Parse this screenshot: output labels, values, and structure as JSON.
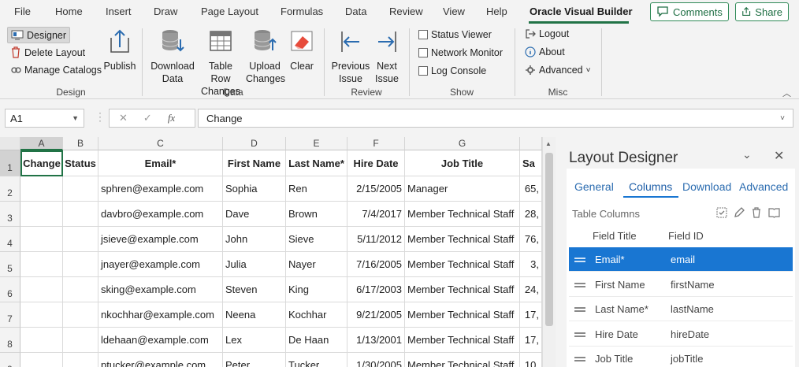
{
  "tabs": [
    "File",
    "Home",
    "Insert",
    "Draw",
    "Page Layout",
    "Formulas",
    "Data",
    "Review",
    "View",
    "Help",
    "Oracle Visual Builder"
  ],
  "comments_label": "Comments",
  "share_label": "Share",
  "ribbon": {
    "design": {
      "designer": "Designer",
      "delete_layout": "Delete Layout",
      "manage_catalogs": "Manage Catalogs",
      "publish": "Publish",
      "label": "Design"
    },
    "data": {
      "download1": "Download",
      "download2": "Data",
      "trc1": "Table Row",
      "trc2": "Changes",
      "upload1": "Upload",
      "upload2": "Changes",
      "clear": "Clear",
      "label": "Data"
    },
    "review": {
      "prev1": "Previous",
      "prev2": "Issue",
      "next1": "Next",
      "next2": "Issue",
      "label": "Review"
    },
    "show": {
      "status_viewer": "Status Viewer",
      "network_monitor": "Network Monitor",
      "log_console": "Log Console",
      "label": "Show"
    },
    "misc": {
      "logout": "Logout",
      "about": "About",
      "advanced": "Advanced",
      "label": "Misc"
    }
  },
  "formula": {
    "name_box": "A1",
    "fx": "fx",
    "value": "Change"
  },
  "grid": {
    "col_letters": [
      "A",
      "B",
      "C",
      "D",
      "E",
      "F",
      "G",
      ""
    ],
    "headers": [
      "Change",
      "Status",
      "Email*",
      "First Name",
      "Last Name*",
      "Hire Date",
      "Job Title",
      "Sa"
    ],
    "rows": [
      {
        "n": "2",
        "email": "sphren@example.com",
        "first": "Sophia",
        "last": "Ren",
        "hire": "2/15/2005",
        "job": "Manager",
        "sal": "65,"
      },
      {
        "n": "3",
        "email": "davbro@example.com",
        "first": "Dave",
        "last": "Brown",
        "hire": "7/4/2017",
        "job": "Member Technical Staff",
        "sal": "28,"
      },
      {
        "n": "4",
        "email": "jsieve@example.com",
        "first": "John",
        "last": "Sieve",
        "hire": "5/11/2012",
        "job": "Member Technical Staff",
        "sal": "76,"
      },
      {
        "n": "5",
        "email": "jnayer@example.com",
        "first": "Julia",
        "last": "Nayer",
        "hire": "7/16/2005",
        "job": "Member Technical Staff",
        "sal": "3,"
      },
      {
        "n": "6",
        "email": "sking@example.com",
        "first": "Steven",
        "last": "King",
        "hire": "6/17/2003",
        "job": "Member Technical Staff",
        "sal": "24,"
      },
      {
        "n": "7",
        "email": "nkochhar@example.com",
        "first": "Neena",
        "last": "Kochhar",
        "hire": "9/21/2005",
        "job": "Member Technical Staff",
        "sal": "17,"
      },
      {
        "n": "8",
        "email": "ldehaan@example.com",
        "first": "Lex",
        "last": "De Haan",
        "hire": "1/13/2001",
        "job": "Member Technical Staff",
        "sal": "17,"
      },
      {
        "n": "9",
        "email": "ptucker@example.com",
        "first": "Peter",
        "last": "Tucker",
        "hire": "1/30/2005",
        "job": "Member Technical Staff",
        "sal": "10,"
      }
    ]
  },
  "pane": {
    "title": "Layout Designer",
    "tabs": [
      "General",
      "Columns",
      "Download",
      "Advanced"
    ],
    "section": "Table Columns",
    "col_field_title": "Field Title",
    "col_field_id": "Field ID",
    "fields": [
      {
        "title": "Email*",
        "id": "email"
      },
      {
        "title": "First Name",
        "id": "firstName"
      },
      {
        "title": "Last Name*",
        "id": "lastName"
      },
      {
        "title": "Hire Date",
        "id": "hireDate"
      },
      {
        "title": "Job Title",
        "id": "jobTitle"
      }
    ]
  },
  "colors": {
    "accent_green": "#217346",
    "accent_blue": "#1976d2",
    "link_blue": "#2b6cb0"
  }
}
